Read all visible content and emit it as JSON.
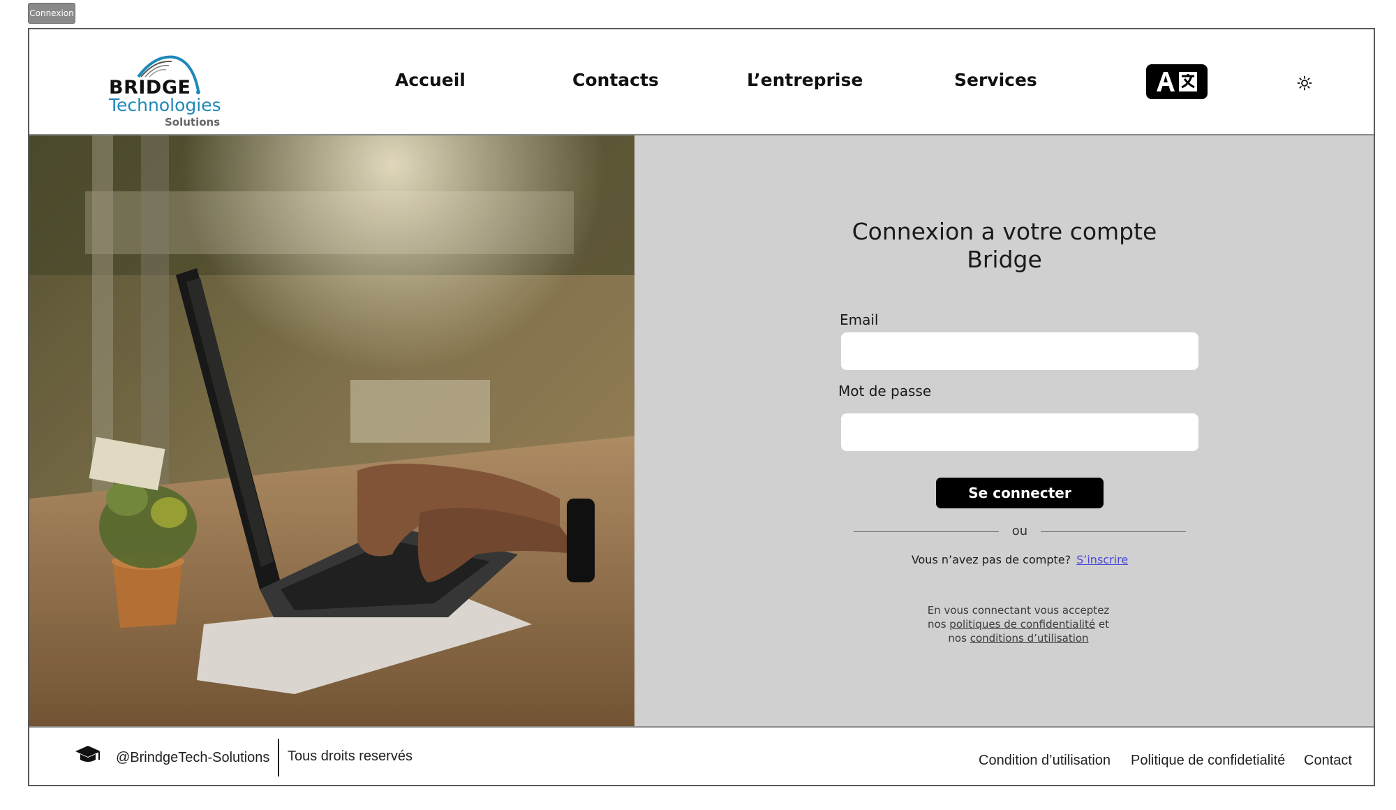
{
  "frame": {
    "label": "Connexion"
  },
  "brand": {
    "line1": "BRIDGE",
    "line2": "Technologies",
    "line3": "Solutions",
    "accent": "#1e88b8"
  },
  "nav": {
    "items": [
      {
        "label": "Accueil"
      },
      {
        "label": "Contacts"
      },
      {
        "label": "L’entreprise"
      },
      {
        "label": "Services"
      }
    ],
    "language_icon": "translate-icon",
    "theme_icon": "sun-icon"
  },
  "hero": {
    "image": "laptop-on-desk-photo"
  },
  "login": {
    "title_line1": "Connexion a votre compte",
    "title_line2": "Bridge",
    "email_label": "Email",
    "email_value": "",
    "password_label": "Mot de passe",
    "password_value": "",
    "submit_label": "Se connecter",
    "or_label": "ou",
    "no_account_text": "Vous n’avez pas de compte?",
    "signup_link": "S’inscrire",
    "legal_part1": "En vous connectant vous acceptez",
    "legal_part2": "nos",
    "privacy_link": "politiques de confidentialité",
    "legal_part3": "et",
    "legal_part4": "nos",
    "terms_link": "conditions d’utilisation",
    "panel_bg": "#d0d0d0",
    "link_color": "#4a4ad8"
  },
  "footer": {
    "icon": "graduation-cap-icon",
    "handle": "@BrindgeTech-Solutions",
    "rights": "Tous droits reservés",
    "links": [
      "Condition d’utilisation",
      "Politique de confidetialité",
      "Contact"
    ]
  }
}
